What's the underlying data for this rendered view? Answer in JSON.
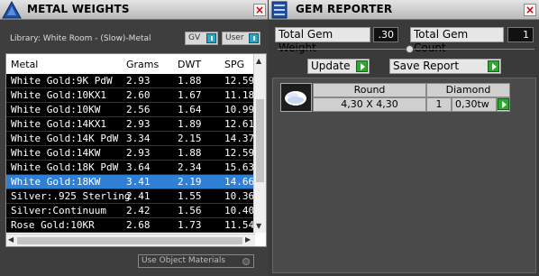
{
  "metal_panel": {
    "title": "METAL WEIGHTS",
    "close": "×",
    "library": "Library: White Room - (Slow)-Metal",
    "gv_label": "GV",
    "user_label": "User",
    "columns": [
      "Metal",
      "Grams",
      "DWT",
      "SPG"
    ],
    "rows": [
      {
        "metal": "White Gold:9K PdW",
        "grams": "2.93",
        "dwt": "1.88",
        "spg": "12.59"
      },
      {
        "metal": "White Gold:10KX1",
        "grams": "2.60",
        "dwt": "1.67",
        "spg": "11.18"
      },
      {
        "metal": "White Gold:10KW",
        "grams": "2.56",
        "dwt": "1.64",
        "spg": "10.99"
      },
      {
        "metal": "White Gold:14KX1",
        "grams": "2.93",
        "dwt": "1.89",
        "spg": "12.61"
      },
      {
        "metal": "White Gold:14K PdW",
        "grams": "3.34",
        "dwt": "2.15",
        "spg": "14.37"
      },
      {
        "metal": "White Gold:14KW",
        "grams": "2.93",
        "dwt": "1.88",
        "spg": "12.59"
      },
      {
        "metal": "White Gold:18K PdW",
        "grams": "3.64",
        "dwt": "2.34",
        "spg": "15.63"
      },
      {
        "metal": "White Gold:18KW",
        "grams": "3.41",
        "dwt": "2.19",
        "spg": "14.66",
        "selected": true
      },
      {
        "metal": "Silver:.925 Sterling",
        "grams": "2.41",
        "dwt": "1.55",
        "spg": "10.36"
      },
      {
        "metal": "Silver:Continuum",
        "grams": "2.42",
        "dwt": "1.56",
        "spg": "10.40"
      },
      {
        "metal": "Rose Gold:10KR",
        "grams": "2.68",
        "dwt": "1.73",
        "spg": "11.54"
      }
    ],
    "use_object_materials": "Use Object Materials"
  },
  "gem_panel": {
    "title": "GEM REPORTER",
    "close": "×",
    "total_weight_label": "Total Gem Weight",
    "total_weight_value": ".30",
    "total_count_label": "Total Gem Count",
    "total_count_value": "1",
    "update_label": "Update",
    "save_report_label": "Save Report",
    "gem": {
      "shape": "Round",
      "type": "Diamond",
      "size": "4,30 X 4,30",
      "count": "1",
      "weight": "0,30tw"
    }
  },
  "colors": {
    "selection": "#2f7fd6",
    "go_green": "#2fa82f",
    "toggle_cyan": "#28a6c8"
  }
}
